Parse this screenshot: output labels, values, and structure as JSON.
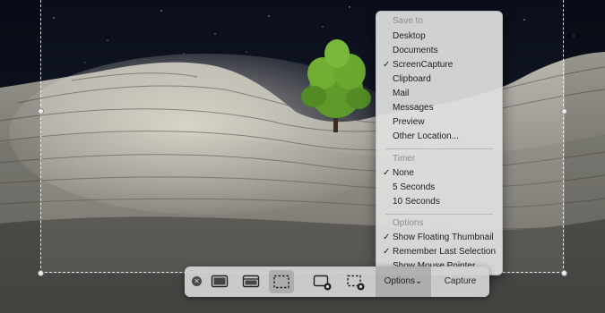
{
  "menu": {
    "sections": [
      {
        "header": "Save to",
        "items": [
          {
            "label": "Desktop",
            "checked": false
          },
          {
            "label": "Documents",
            "checked": false
          },
          {
            "label": "ScreenCapture",
            "checked": true
          },
          {
            "label": "Clipboard",
            "checked": false
          },
          {
            "label": "Mail",
            "checked": false
          },
          {
            "label": "Messages",
            "checked": false
          },
          {
            "label": "Preview",
            "checked": false
          },
          {
            "label": "Other Location...",
            "checked": false
          }
        ]
      },
      {
        "header": "Timer",
        "items": [
          {
            "label": "None",
            "checked": true
          },
          {
            "label": "5 Seconds",
            "checked": false
          },
          {
            "label": "10 Seconds",
            "checked": false
          }
        ]
      },
      {
        "header": "Options",
        "items": [
          {
            "label": "Show Floating Thumbnail",
            "checked": true
          },
          {
            "label": "Remember Last Selection",
            "checked": true
          },
          {
            "label": "Show Mouse Pointer",
            "checked": false
          }
        ]
      }
    ],
    "check_glyph": "✓"
  },
  "toolbar": {
    "close_glyph": "✕",
    "buttons": [
      {
        "name": "capture-entire-screen-icon",
        "active": false
      },
      {
        "name": "capture-window-icon",
        "active": false
      },
      {
        "name": "capture-selection-icon",
        "active": true
      },
      {
        "name": "record-entire-screen-icon",
        "active": false
      },
      {
        "name": "record-selection-icon",
        "active": false
      }
    ],
    "options_label": "Options",
    "options_chevron": "⌄",
    "capture_label": "Capture"
  }
}
